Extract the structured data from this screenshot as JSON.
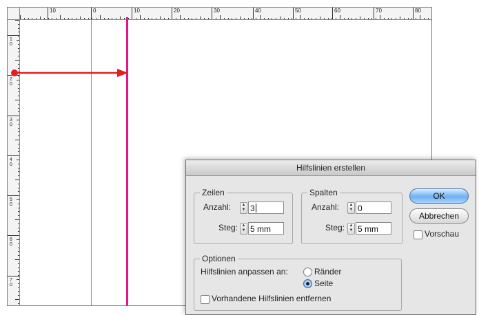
{
  "ruler": {
    "h_labels": [
      "10",
      "0",
      "10",
      "20",
      "30",
      "40",
      "50",
      "60",
      "70",
      "80"
    ],
    "v_labels": [
      "1\n0",
      "2\n0",
      "3\n0",
      "4\n0",
      "5\n0",
      "6\n0",
      "7\n0"
    ]
  },
  "colors": {
    "guide": "#e0168c",
    "arrow": "#e0201e",
    "column_guide": "#8c87c8"
  },
  "dialog": {
    "title": "Hilfslinien erstellen",
    "rows": {
      "legend": "Zeilen",
      "count_label": "Anzahl:",
      "count_value": "3",
      "gutter_label": "Steg:",
      "gutter_value": "5 mm"
    },
    "columns": {
      "legend": "Spalten",
      "count_label": "Anzahl:",
      "count_value": "0",
      "gutter_label": "Steg:",
      "gutter_value": "5 mm"
    },
    "options": {
      "legend": "Optionen",
      "fit_label": "Hilfslinien anpassen an:",
      "radio_margins": "Ränder",
      "radio_page": "Seite",
      "remove_existing": "Vorhandene Hilfslinien entfernen"
    },
    "ok_label": "OK",
    "cancel_label": "Abbrechen",
    "preview_label": "Vorschau"
  }
}
